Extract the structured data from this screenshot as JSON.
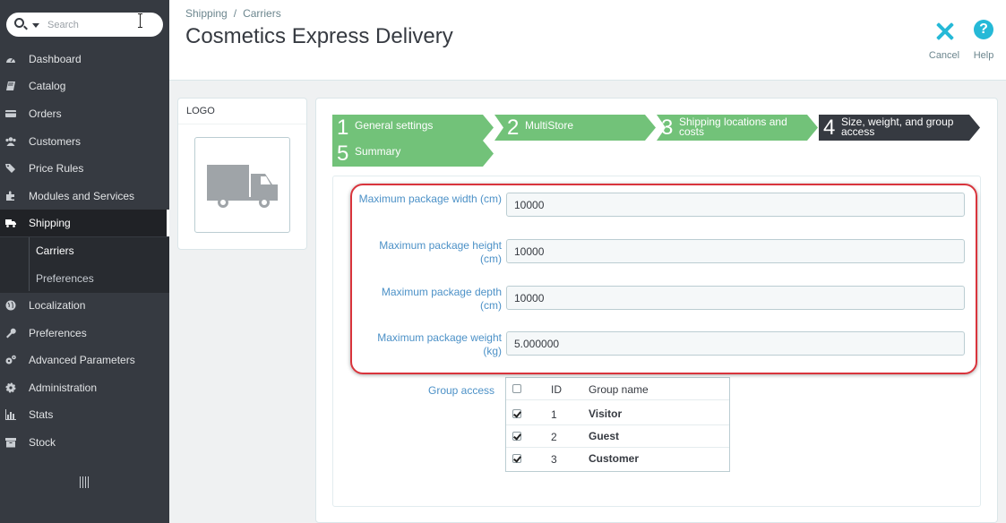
{
  "search": {
    "placeholder": "Search"
  },
  "sidebar": {
    "items": [
      {
        "label": "Dashboard",
        "icon": "dashboard-icon"
      },
      {
        "label": "Catalog",
        "icon": "book-icon"
      },
      {
        "label": "Orders",
        "icon": "credit-card-icon"
      },
      {
        "label": "Customers",
        "icon": "users-icon"
      },
      {
        "label": "Price Rules",
        "icon": "tag-icon"
      },
      {
        "label": "Modules and Services",
        "icon": "puzzle-icon"
      },
      {
        "label": "Shipping",
        "icon": "truck-icon"
      },
      {
        "label": "Localization",
        "icon": "globe-icon"
      },
      {
        "label": "Preferences",
        "icon": "wrench-icon"
      },
      {
        "label": "Advanced Parameters",
        "icon": "gears-icon"
      },
      {
        "label": "Administration",
        "icon": "gear-icon"
      },
      {
        "label": "Stats",
        "icon": "bar-chart-icon"
      },
      {
        "label": "Stock",
        "icon": "archive-icon"
      }
    ],
    "sub_items": [
      {
        "label": "Carriers"
      },
      {
        "label": "Preferences"
      }
    ]
  },
  "header": {
    "breadcrumb": [
      "Shipping",
      "Carriers"
    ],
    "breadcrumb_sep": "/",
    "title": "Cosmetics Express Delivery",
    "cancel_label": "Cancel",
    "help_label": "Help"
  },
  "logo_panel": {
    "title": "LOGO"
  },
  "wizard": {
    "steps": [
      {
        "num": "1",
        "label": "General settings",
        "state": "done"
      },
      {
        "num": "2",
        "label": "MultiStore",
        "state": "done"
      },
      {
        "num": "3",
        "label": "Shipping locations and costs",
        "state": "done"
      },
      {
        "num": "4",
        "label": "Size, weight, and group access",
        "state": "current"
      },
      {
        "num": "5",
        "label": "Summary",
        "state": "done"
      }
    ]
  },
  "form": {
    "fields": [
      {
        "label": "Maximum package width (cm)",
        "value": "10000"
      },
      {
        "label": "Maximum package height (cm)",
        "value": "10000"
      },
      {
        "label": "Maximum package depth (cm)",
        "value": "10000"
      },
      {
        "label": "Maximum package weight (kg)",
        "value": "5.000000"
      }
    ],
    "group_access": {
      "label": "Group access",
      "headers": {
        "id": "ID",
        "name": "Group name"
      },
      "rows": [
        {
          "id": "1",
          "name": "Visitor",
          "checked": true
        },
        {
          "id": "2",
          "name": "Guest",
          "checked": true
        },
        {
          "id": "3",
          "name": "Customer",
          "checked": true
        }
      ]
    }
  },
  "colors": {
    "sidebar_bg": "#363a41",
    "step_done": "#72c279",
    "step_current": "#363a41",
    "accent": "#25b9d7",
    "label_blue": "#4c91c7",
    "highlight": "#d9343c"
  }
}
